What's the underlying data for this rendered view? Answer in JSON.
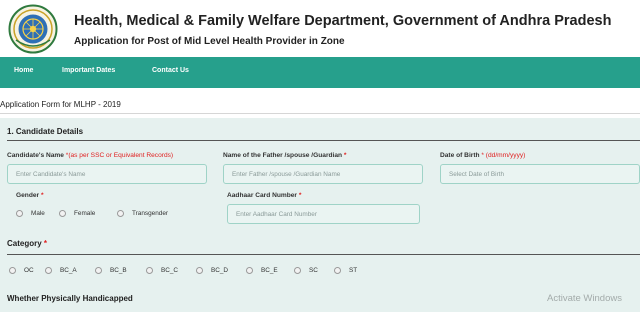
{
  "header": {
    "title": "Health, Medical & Family Welfare Department, Government of Andhra Pradesh",
    "subtitle": "Application for Post of Mid Level Health Provider in Zone"
  },
  "nav": {
    "items": [
      "Home",
      "Important Dates",
      "Contact Us"
    ]
  },
  "form": {
    "heading": "Application Form for MLHP - 2019",
    "section1_title": "1. Candidate Details",
    "candidate_name": {
      "label": "Candidate's Name",
      "note": "*(as per SSC or Equivalent Records)",
      "placeholder": "Enter Candidate's Name"
    },
    "father_name": {
      "label": "Name of the Father /spouse /Guardian",
      "required": "*",
      "placeholder": "Enter Father /spouse /Guardian Name"
    },
    "dob": {
      "label": "Date of Birth",
      "note": "* (dd/mm/yyyy)",
      "placeholder": "Select Date of Birth"
    },
    "gender": {
      "label": "Gender",
      "required": "*",
      "options": [
        "Male",
        "Female",
        "Transgender"
      ]
    },
    "aadhaar": {
      "label": "Aadhaar Card Number",
      "required": "*",
      "placeholder": "Enter Aadhaar Card Number"
    },
    "category": {
      "label": "Category",
      "required": "*",
      "options": [
        "OC",
        "BC_A",
        "BC_B",
        "BC_C",
        "BC_D",
        "BC_E",
        "SC",
        "ST"
      ]
    },
    "physically_handicapped": {
      "label": "Whether Physically Handicapped"
    }
  },
  "system": {
    "watermark": "Activate Windows"
  },
  "colors": {
    "nav_bg": "#26a08c",
    "form_bg": "#e6f1ef",
    "input_border": "#9fd3c7",
    "required": "#e02020"
  },
  "icons": {
    "logo": "andhra-pradesh-emblem-icon"
  }
}
